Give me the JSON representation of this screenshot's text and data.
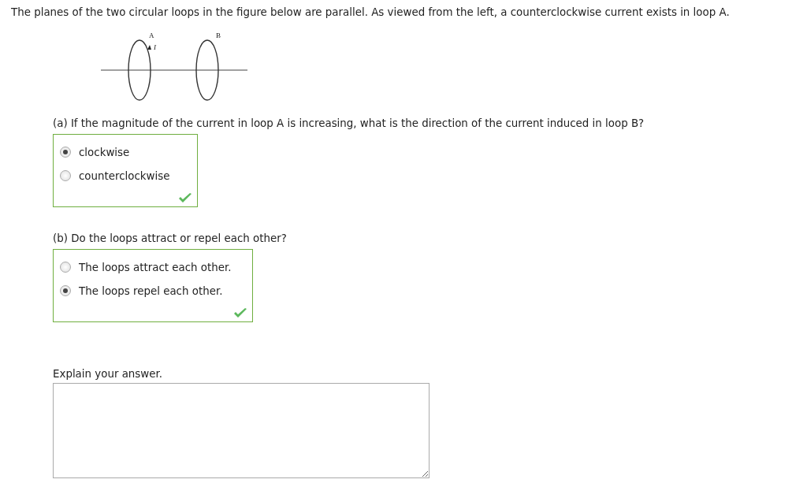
{
  "intro": "The planes of the two circular loops in the figure below are parallel. As viewed from the left, a counterclockwise current exists in loop A.",
  "figure": {
    "loop_labels": [
      "A",
      "B"
    ],
    "current_label": "I"
  },
  "questions": [
    {
      "prompt": "(a) If the magnitude of the current in loop A is increasing, what is the direction of the current induced in loop B?",
      "correct": true,
      "options": [
        {
          "label": "clockwise",
          "selected": true
        },
        {
          "label": "counterclockwise",
          "selected": false
        }
      ]
    },
    {
      "prompt": "(b) Do the loops attract or repel each other?",
      "correct": true,
      "options": [
        {
          "label": "The loops attract each other.",
          "selected": false
        },
        {
          "label": "The loops repel each other.",
          "selected": true
        }
      ]
    }
  ],
  "explain": {
    "label": "Explain your answer."
  }
}
